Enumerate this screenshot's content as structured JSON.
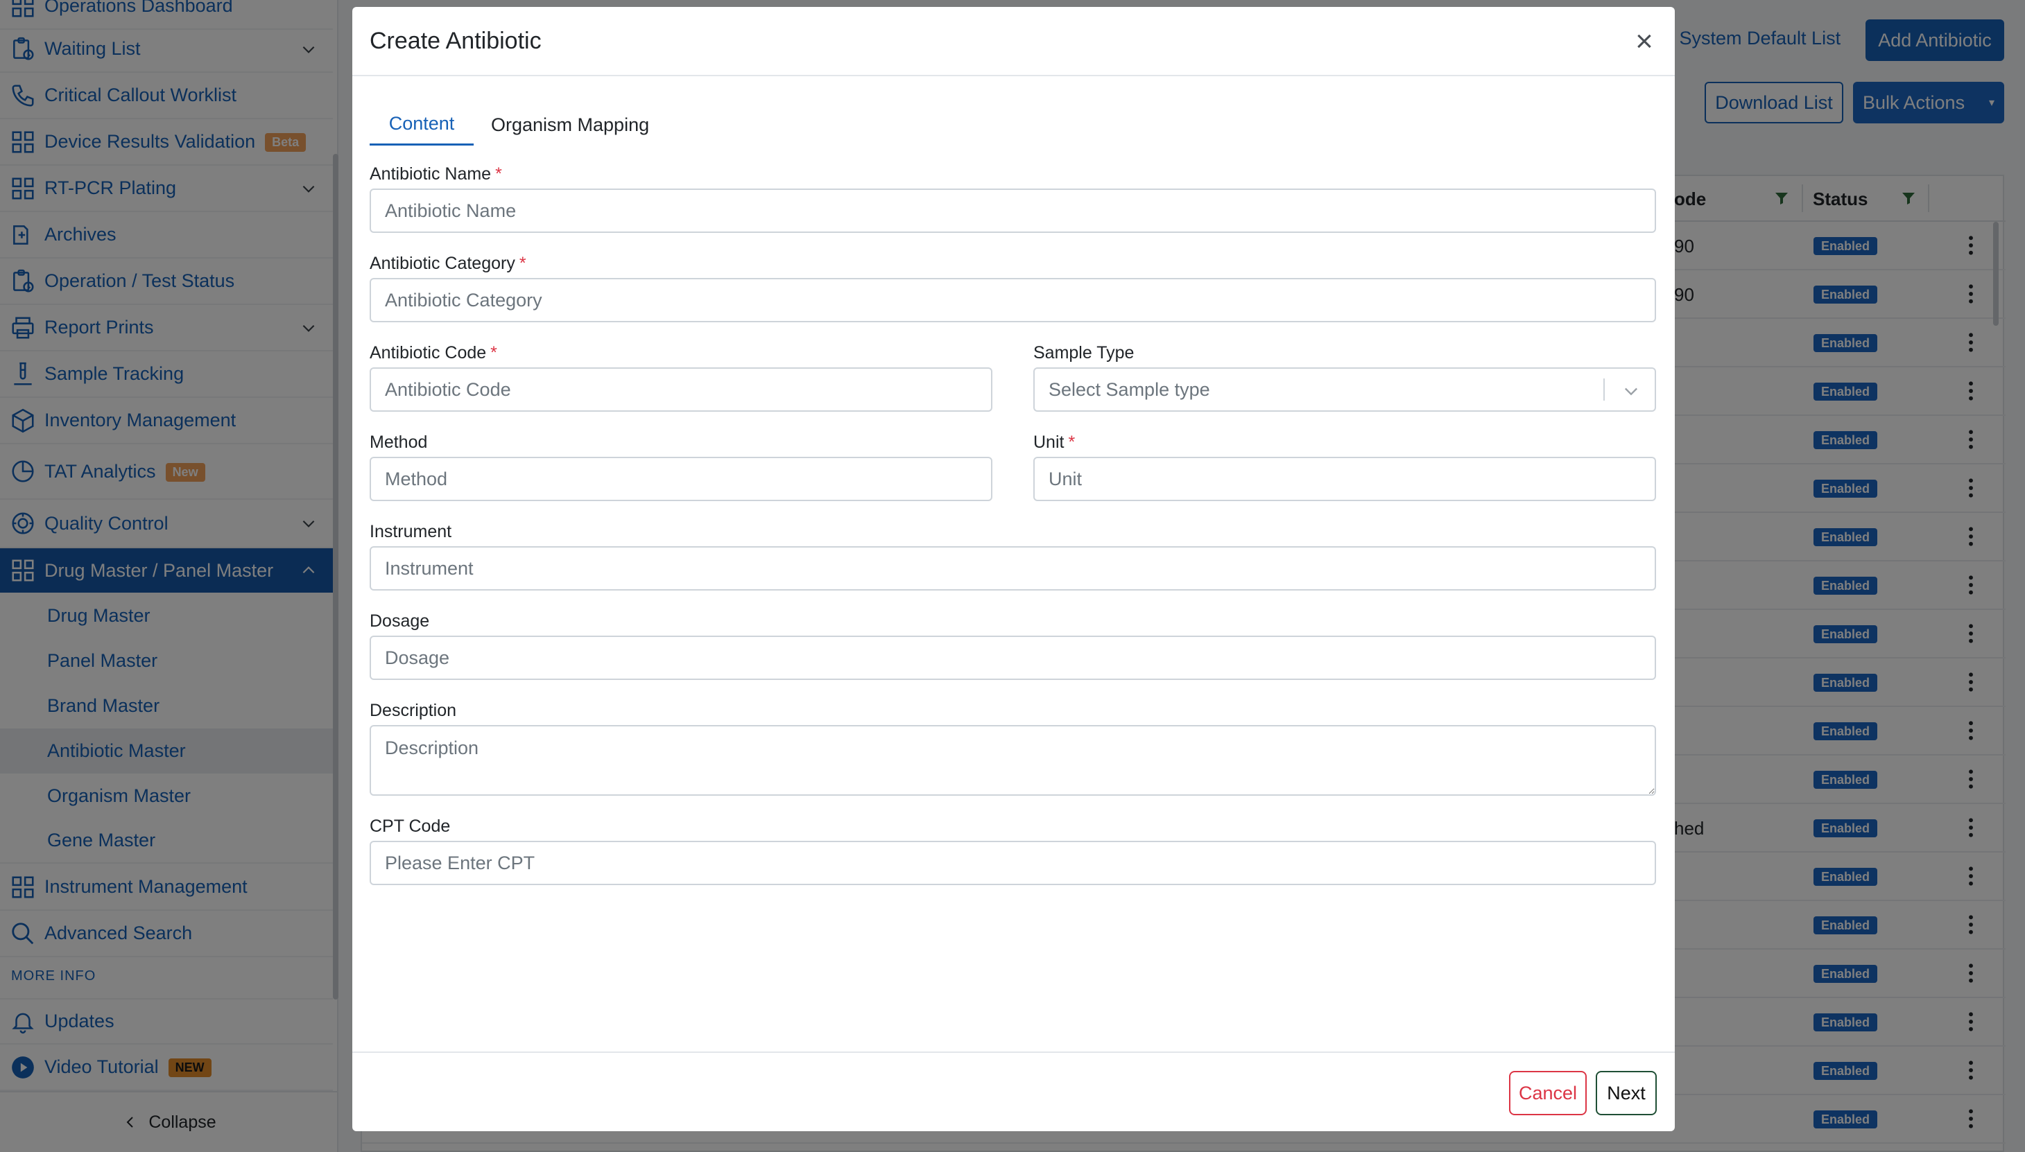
{
  "sidebar": {
    "items": [
      {
        "label": "Operations Dashboard",
        "icon": "grid-icon"
      },
      {
        "label": "Waiting List",
        "icon": "clipboard-clock-icon",
        "has_chevron": true
      },
      {
        "label": "Critical Callout Worklist",
        "icon": "phone-icon"
      },
      {
        "label": "Device Results Validation",
        "icon": "grid-icon",
        "badge": "Beta"
      },
      {
        "label": "RT-PCR Plating",
        "icon": "grid-icon",
        "has_chevron": true
      },
      {
        "label": "Archives",
        "icon": "archive-icon"
      },
      {
        "label": "Operation / Test Status",
        "icon": "clipboard-clock-icon"
      },
      {
        "label": "Report Prints",
        "icon": "printer-icon",
        "has_chevron": true
      },
      {
        "label": "Sample Tracking",
        "icon": "test-tube-icon"
      },
      {
        "label": "Inventory Management",
        "icon": "box-icon"
      },
      {
        "label": "TAT Analytics",
        "icon": "pie-chart-icon",
        "badge": "New"
      },
      {
        "label": "Quality Control",
        "icon": "gear-badge-icon",
        "has_chevron": true
      },
      {
        "label": "Drug Master / Panel Master",
        "icon": "grid-icon",
        "expanded": true
      }
    ],
    "sub_items": [
      {
        "label": "Drug Master"
      },
      {
        "label": "Panel Master"
      },
      {
        "label": "Brand Master"
      },
      {
        "label": "Antibiotic Master",
        "active": true
      },
      {
        "label": "Organism Master"
      },
      {
        "label": "Gene Master"
      }
    ],
    "items_after": [
      {
        "label": "Instrument Management",
        "icon": "grid-icon"
      },
      {
        "label": "Advanced Search",
        "icon": "search-icon"
      }
    ],
    "section_label": "MORE INFO",
    "info_items": [
      {
        "label": "Updates",
        "icon": "bell-icon"
      },
      {
        "label": "Video Tutorial",
        "icon": "play-circle-icon",
        "badge": "NEW"
      }
    ],
    "collapse_label": "Collapse"
  },
  "background": {
    "system_default_link": "r System Default List",
    "add_button": "Add Antibiotic",
    "download_button": "Download List",
    "bulk_button": "Bulk Actions",
    "columns": {
      "code": "ode",
      "status": "Status"
    },
    "row_codes": [
      "90",
      "90",
      "",
      "",
      "",
      "",
      "",
      "",
      "",
      "",
      "",
      "",
      "hed",
      "",
      "",
      "",
      "",
      "",
      ""
    ],
    "status_value": "Enabled"
  },
  "modal": {
    "title": "Create Antibiotic",
    "close_symbol": "×",
    "tabs": [
      {
        "label": "Content",
        "active": true
      },
      {
        "label": "Organism Mapping",
        "active": false
      }
    ],
    "fields": {
      "antibiotic_name": {
        "label": "Antibiotic Name",
        "placeholder": "Antibiotic Name",
        "value": "",
        "required": true
      },
      "antibiotic_category": {
        "label": "Antibiotic Category",
        "placeholder": "Antibiotic Category",
        "value": "",
        "required": true
      },
      "antibiotic_code": {
        "label": "Antibiotic Code",
        "placeholder": "Antibiotic Code",
        "value": "",
        "required": true
      },
      "sample_type": {
        "label": "Sample Type",
        "placeholder": "Select Sample type",
        "value": ""
      },
      "method": {
        "label": "Method",
        "placeholder": "Method",
        "value": ""
      },
      "unit": {
        "label": "Unit",
        "placeholder": "Unit",
        "value": "",
        "required": true
      },
      "instrument": {
        "label": "Instrument",
        "placeholder": "Instrument",
        "value": ""
      },
      "dosage": {
        "label": "Dosage",
        "placeholder": "Dosage",
        "value": ""
      },
      "description": {
        "label": "Description",
        "placeholder": "Description",
        "value": ""
      },
      "cpt_code": {
        "label": "CPT Code",
        "placeholder": "Please Enter CPT",
        "value": ""
      }
    },
    "required_mark": "*",
    "cancel_label": "Cancel",
    "next_label": "Next"
  },
  "colors": {
    "brand_blue": "#1761b6",
    "accent": "#1d66c2",
    "danger": "#dc3545",
    "active_bg": "#1658a8"
  }
}
